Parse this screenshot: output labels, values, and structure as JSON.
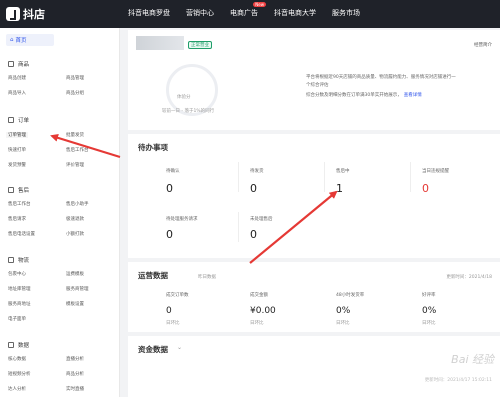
{
  "app": {
    "logo_text": "抖店"
  },
  "topnav": [
    {
      "label": "抖音电商罗盘"
    },
    {
      "label": "营销中心"
    },
    {
      "label": "电商广告",
      "badge": "New"
    },
    {
      "label": "抖音电商大学"
    },
    {
      "label": "服务市场"
    }
  ],
  "sidebar": {
    "home": "首页",
    "groups": [
      {
        "title": "商品",
        "items": [
          "商品创建",
          "商品管理",
          "商品导入",
          "商品分组"
        ]
      },
      {
        "title": "订单",
        "items": [
          "订单管理",
          "批量发货",
          "快速打单",
          "售后工作台",
          "发货预警",
          "评价管理"
        ]
      },
      {
        "title": "售后",
        "items": [
          "售后工作台",
          "售后小助手",
          "售后请求",
          "极速退款",
          "售后电话设置",
          "小额打款"
        ]
      },
      {
        "title": "物流",
        "items": [
          "包裹中心",
          "运费模板",
          "地址库管理",
          "服务商管理",
          "服务商地址",
          "模板设置",
          "电子面单"
        ]
      },
      {
        "title": "数据",
        "items": [
          "核心数据",
          "直播分析",
          "短视频分析",
          "商品分析",
          "达人分析",
          "实时直播"
        ]
      }
    ]
  },
  "shop": {
    "status": "正常营业",
    "score_link": "经营简介",
    "gauge_text": "体验分",
    "gauge_caption": "较前一日 - 落于1%的同行",
    "desc_lines": [
      "平台将根据近90天店铺的商品质量、物流履约能力、服务情况对店铺进行一",
      "个综合评估",
      "综合分数及明细分数在订单满30单实开始展示，"
    ],
    "desc_link": "查看详情"
  },
  "todo": {
    "title": "待办事项",
    "items": [
      {
        "label": "待确认",
        "value": "0"
      },
      {
        "label": "待发货",
        "value": "0"
      },
      {
        "label": "售后中",
        "value": "1"
      },
      {
        "label": "当日违规提醒",
        "value": "0"
      },
      {
        "label": "待处理服务请求",
        "value": "0"
      },
      {
        "label": "未处理售后",
        "value": "0"
      }
    ]
  },
  "ops": {
    "title": "运营数据",
    "subtitle": "昨日数据",
    "update": "更新时间：2021/4/18",
    "metrics": [
      {
        "label": "成交订单数",
        "value": "0",
        "sub": "日环比"
      },
      {
        "label": "成交金额",
        "value": "¥0.00",
        "sub": "日环比"
      },
      {
        "label": "48小时发货率",
        "value": "0%",
        "sub": "日环比"
      },
      {
        "label": "好评率",
        "value": "0%",
        "sub": "日环比"
      }
    ]
  },
  "funds": {
    "title": "资金数据",
    "watermark": "Bai 经验",
    "watermark_sub": "更新时间：2021/4/17 15:02:11"
  },
  "colors": {
    "topbar": "#1f2229",
    "accent": "#2f54eb",
    "alert": "#e53935",
    "annotation": "#e53935"
  }
}
